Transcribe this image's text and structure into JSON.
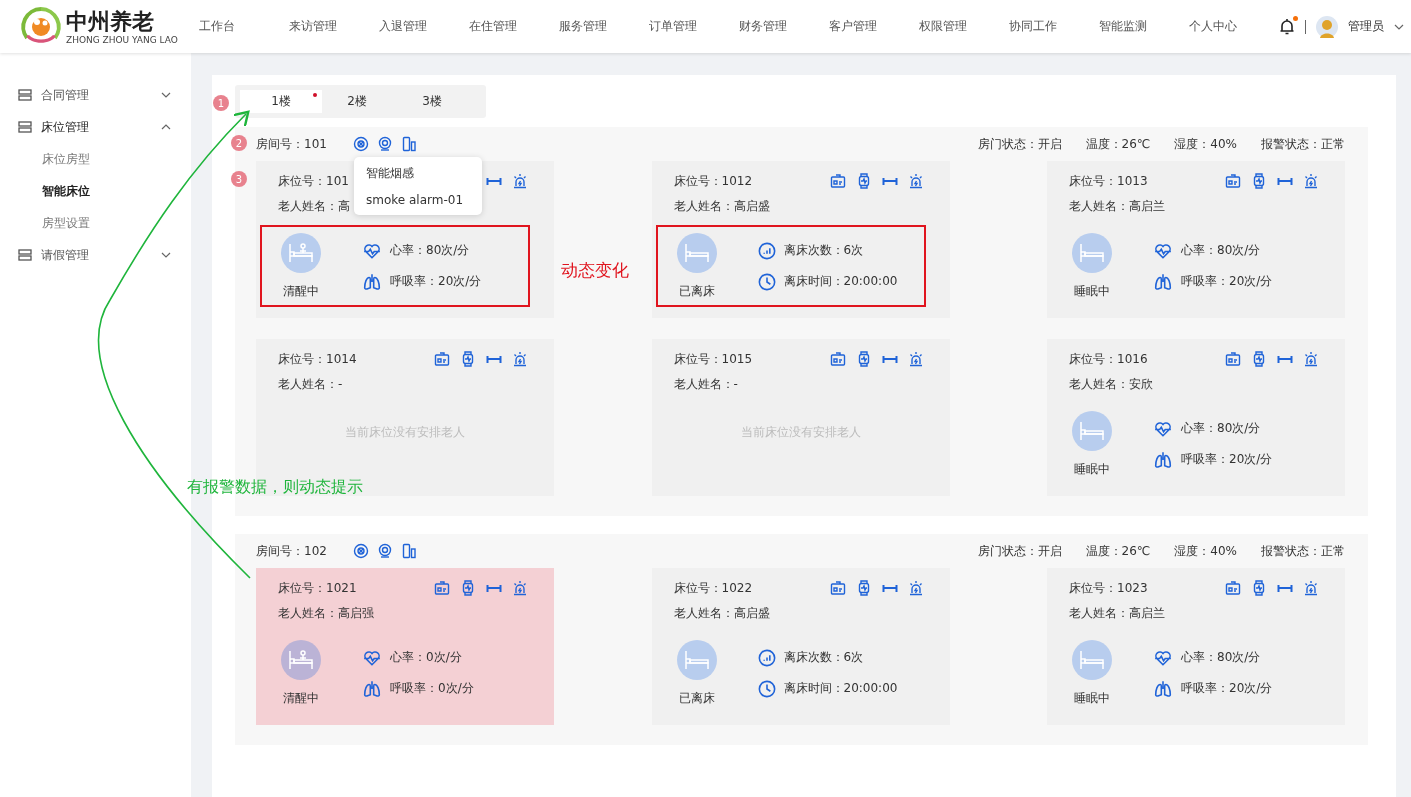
{
  "header": {
    "logo_title": "中州养老",
    "logo_subtitle": "ZHONG ZHOU YANG LAO",
    "nav": [
      {
        "label": "工作台"
      },
      {
        "label": "来访管理"
      },
      {
        "label": "入退管理"
      },
      {
        "label": "在住管理"
      },
      {
        "label": "服务管理"
      },
      {
        "label": "订单管理"
      },
      {
        "label": "财务管理"
      },
      {
        "label": "客户管理"
      },
      {
        "label": "权限管理"
      },
      {
        "label": "协同工作"
      },
      {
        "label": "智能监测"
      },
      {
        "label": "个人中心"
      }
    ],
    "notification_dot": true,
    "user": "管理员"
  },
  "sidebar": {
    "items": [
      {
        "label": "合同管理",
        "expanded": false
      },
      {
        "label": "床位管理",
        "expanded": true,
        "children": [
          {
            "label": "床位房型",
            "selected": false
          },
          {
            "label": "智能床位",
            "selected": true
          },
          {
            "label": "房型设置",
            "selected": false
          }
        ]
      },
      {
        "label": "请假管理",
        "expanded": false
      }
    ]
  },
  "floors": [
    {
      "label": "1楼",
      "selected": true,
      "dot": true
    },
    {
      "label": "2楼",
      "selected": false,
      "dot": false
    },
    {
      "label": "3楼",
      "selected": false,
      "dot": false
    }
  ],
  "rooms": [
    {
      "room": "房间号：101",
      "statuses": [
        "房门状态：开启",
        "温度：26℃",
        "湿度：40%",
        "报警状态：正常"
      ],
      "tooltip": {
        "title": "智能烟感",
        "subtitle": "smoke alarm-01"
      },
      "beds": [
        {
          "kind": "vitals",
          "bed": "床位号：101",
          "elder": "老人姓名：高",
          "status": "清醒中",
          "alert": false,
          "highlighted": true,
          "metrics": [
            {
              "kind": "heart",
              "text": "心率：80次/分"
            },
            {
              "kind": "lungs",
              "text": "呼吸率：20次/分"
            }
          ]
        },
        {
          "kind": "vitals",
          "bed": "床位号：1012",
          "elder": "老人姓名：高启盛",
          "status": "已离床",
          "alert": false,
          "highlighted": true,
          "metrics": [
            {
              "kind": "count",
              "text": "离床次数：6次"
            },
            {
              "kind": "clock",
              "text": "离床时间：20:00:00"
            }
          ]
        },
        {
          "kind": "vitals",
          "bed": "床位号：1013",
          "elder": "老人姓名：高启兰",
          "status": "睡眠中",
          "alert": false,
          "highlighted": false,
          "metrics": [
            {
              "kind": "heart",
              "text": "心率：80次/分"
            },
            {
              "kind": "lungs",
              "text": "呼吸率：20次/分"
            }
          ]
        },
        {
          "kind": "empty",
          "bed": "床位号：1014",
          "elder": "老人姓名：-",
          "message": "当前床位没有安排老人",
          "alert": false
        },
        {
          "kind": "empty",
          "bed": "床位号：1015",
          "elder": "老人姓名：-",
          "message": "当前床位没有安排老人",
          "alert": false
        },
        {
          "kind": "vitals",
          "bed": "床位号：1016",
          "elder": "老人姓名：安欣",
          "status": "睡眠中",
          "alert": false,
          "highlighted": false,
          "metrics": [
            {
              "kind": "heart",
              "text": "心率：80次/分"
            },
            {
              "kind": "lungs",
              "text": "呼吸率：20次/分"
            }
          ]
        }
      ]
    },
    {
      "room": "房间号：102",
      "statuses": [
        "房门状态：开启",
        "温度：26℃",
        "湿度：40%",
        "报警状态：正常"
      ],
      "beds": [
        {
          "kind": "vitals",
          "bed": "床位号：1021",
          "elder": "老人姓名：高启强",
          "status": "清醒中",
          "alert": true,
          "highlighted": false,
          "metrics": [
            {
              "kind": "heart",
              "text": "心率：0次/分"
            },
            {
              "kind": "lungs",
              "text": "呼吸率：0次/分"
            }
          ]
        },
        {
          "kind": "vitals",
          "bed": "床位号：1022",
          "elder": "老人姓名：高启盛",
          "status": "已离床",
          "alert": false,
          "highlighted": false,
          "metrics": [
            {
              "kind": "count",
              "text": "离床次数：6次"
            },
            {
              "kind": "clock",
              "text": "离床时间：20:00:00"
            }
          ]
        },
        {
          "kind": "vitals",
          "bed": "床位号：1023",
          "elder": "老人姓名：高启兰",
          "status": "睡眠中",
          "alert": false,
          "highlighted": false,
          "metrics": [
            {
              "kind": "heart",
              "text": "心率：80次/分"
            },
            {
              "kind": "lungs",
              "text": "呼吸率：20次/分"
            }
          ]
        }
      ]
    }
  ],
  "annotations": {
    "badges": [
      {
        "text": "1"
      },
      {
        "text": "2"
      },
      {
        "text": "3"
      }
    ],
    "notes": [
      {
        "kind": "red",
        "text": "动态变化"
      },
      {
        "kind": "green",
        "text": "有报警数据，则动态提示"
      }
    ],
    "arrow": true
  }
}
